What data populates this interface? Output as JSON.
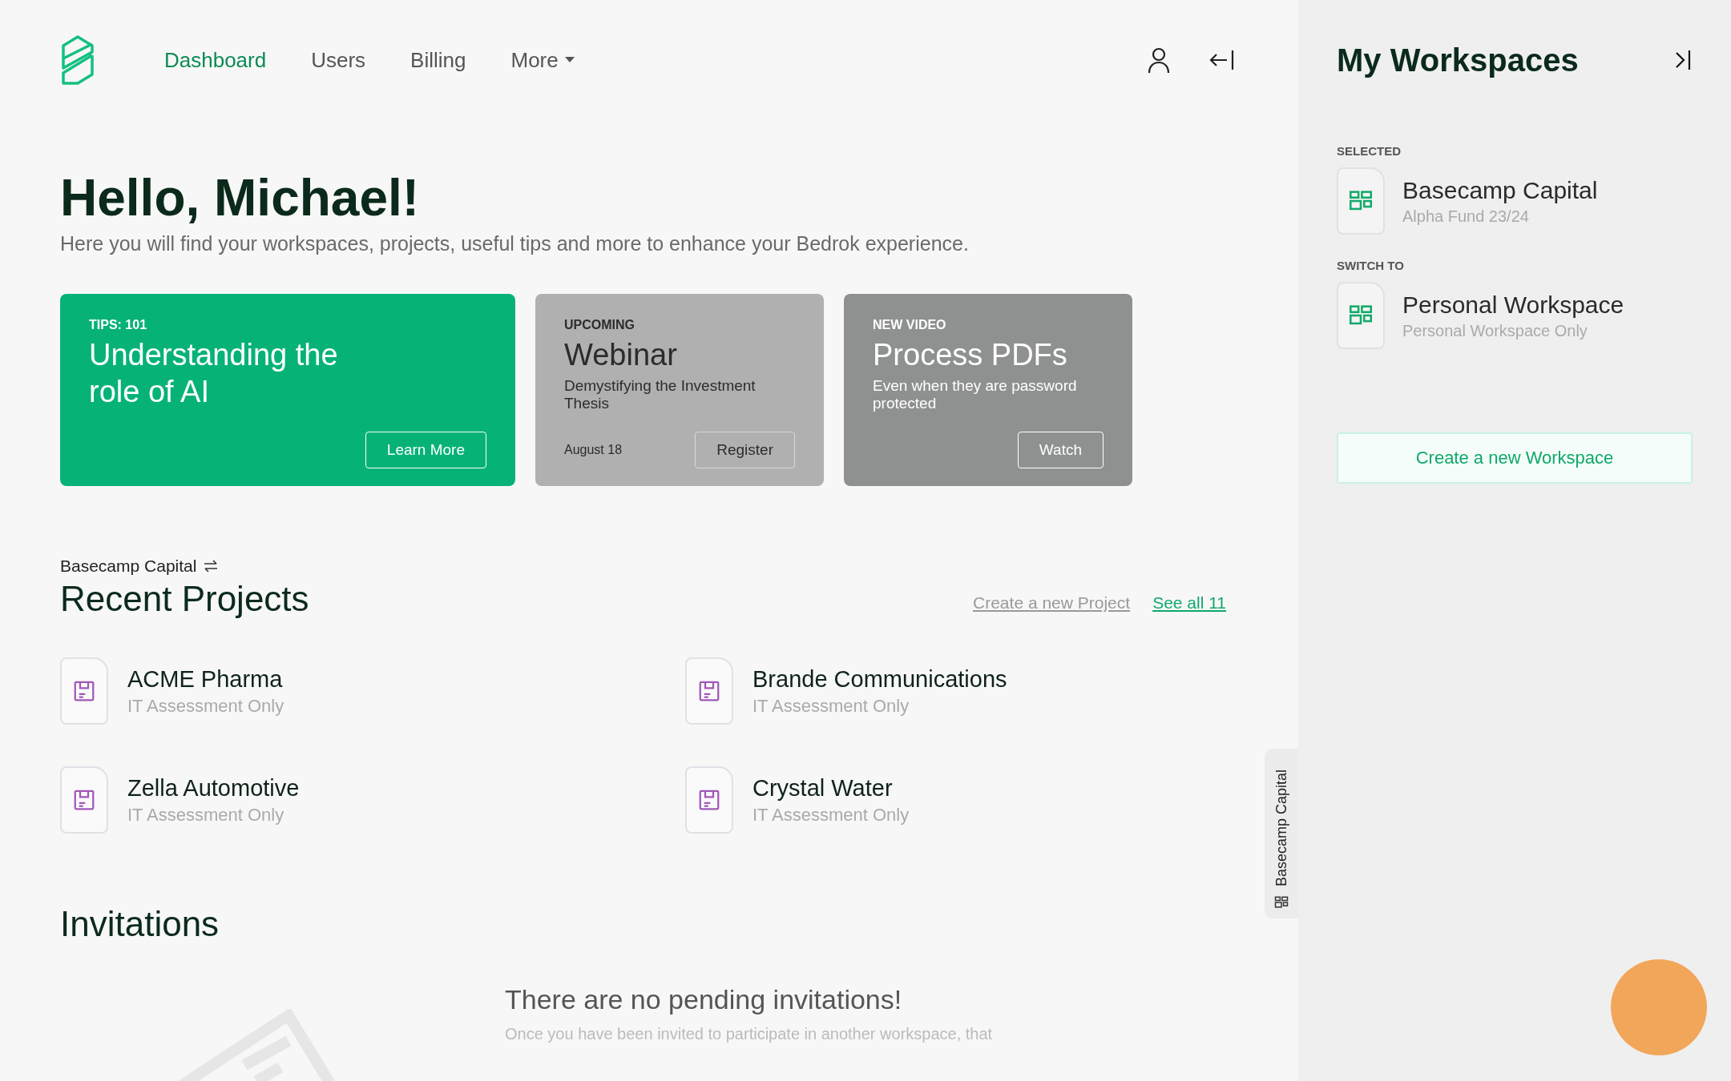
{
  "nav": {
    "items": [
      {
        "label": "Dashboard",
        "selected": true,
        "has_menu": false
      },
      {
        "label": "Users",
        "selected": false,
        "has_menu": false
      },
      {
        "label": "Billing",
        "selected": false,
        "has_menu": false
      },
      {
        "label": "More",
        "selected": false,
        "has_menu": true
      }
    ]
  },
  "greeting": {
    "title": "Hello, Michael!",
    "subtitle": "Here you will find your workspaces, projects, useful tips and more to enhance your Bedrok experience."
  },
  "cards": [
    {
      "kind": "tip",
      "eyebrow": "TIPS: 101",
      "title": "Understanding the role of AI",
      "button": "Learn More"
    },
    {
      "kind": "event",
      "eyebrow": "UPCOMING",
      "title": "Webinar",
      "text": "Demystifying the Investment Thesis",
      "date": "August 18",
      "button": "Register"
    },
    {
      "kind": "video",
      "eyebrow": "NEW VIDEO",
      "title": "Process PDFs",
      "text": "Even when they are password protected",
      "button": "Watch"
    }
  ],
  "projects_section": {
    "workspace": "Basecamp Capital",
    "title": "Recent Projects",
    "create_link": "Create a new Project",
    "see_all_link": "See all 11",
    "items": [
      {
        "name": "ACME Pharma",
        "subtitle": "IT Assessment Only"
      },
      {
        "name": "Brande Communications",
        "subtitle": "IT Assessment Only"
      },
      {
        "name": "Zella Automotive",
        "subtitle": "IT Assessment Only"
      },
      {
        "name": "Crystal Water",
        "subtitle": "IT Assessment Only"
      }
    ]
  },
  "side_tab": {
    "label": "Basecamp Capital"
  },
  "invitations": {
    "title": "Invitations",
    "empty_title": "There are no pending invitations!",
    "empty_text": "Once you have been invited to participate in another workspace, that"
  },
  "sidebar": {
    "title": "My Workspaces",
    "groups": [
      {
        "heading": "SELECTED",
        "items": [
          {
            "name": "Basecamp Capital",
            "subtitle": "Alpha Fund 23/24"
          }
        ]
      },
      {
        "heading": "SWITCH TO",
        "items": [
          {
            "name": "Personal Workspace",
            "subtitle": "Personal Workspace Only"
          }
        ]
      }
    ],
    "button": "Create a new Workspace"
  }
}
